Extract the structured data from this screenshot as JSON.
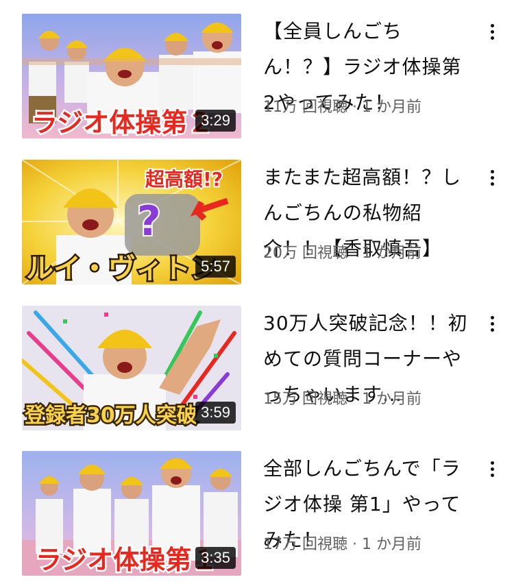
{
  "videos": [
    {
      "title": "【全員しんごちん！？】ラジオ体操第2やってみた！",
      "stats": "11万 回視聴 · 1 か月前",
      "duration": "3:29",
      "thumb_caption": "ラジオ体操第２"
    },
    {
      "title": "またまた超高額！？しんごちんの私物紹介！！【香取慎吾】",
      "stats": "20万 回視聴 · 1 か月前",
      "duration": "5:57",
      "thumb_caption": "ルイ・ヴィトン",
      "thumb_tag": "超高額!?"
    },
    {
      "title": "30万人突破記念！！初めての質問コーナーやっちゃいます…",
      "stats": "15万 回視聴 · 1 か月前",
      "duration": "3:59",
      "thumb_caption": "登録者30万人突破"
    },
    {
      "title": "全部しんごちんで「ラジオ体操 第1」やってみた！",
      "stats": "17万 回視聴 · 1 か月前",
      "duration": "3:35",
      "thumb_caption": "ラジオ体操第１"
    }
  ],
  "colors": {
    "hat_yellow": "#f2c417",
    "caption_red": "#e8281f",
    "caption_gold": "#f7d24a",
    "stats_gray": "#606060"
  }
}
